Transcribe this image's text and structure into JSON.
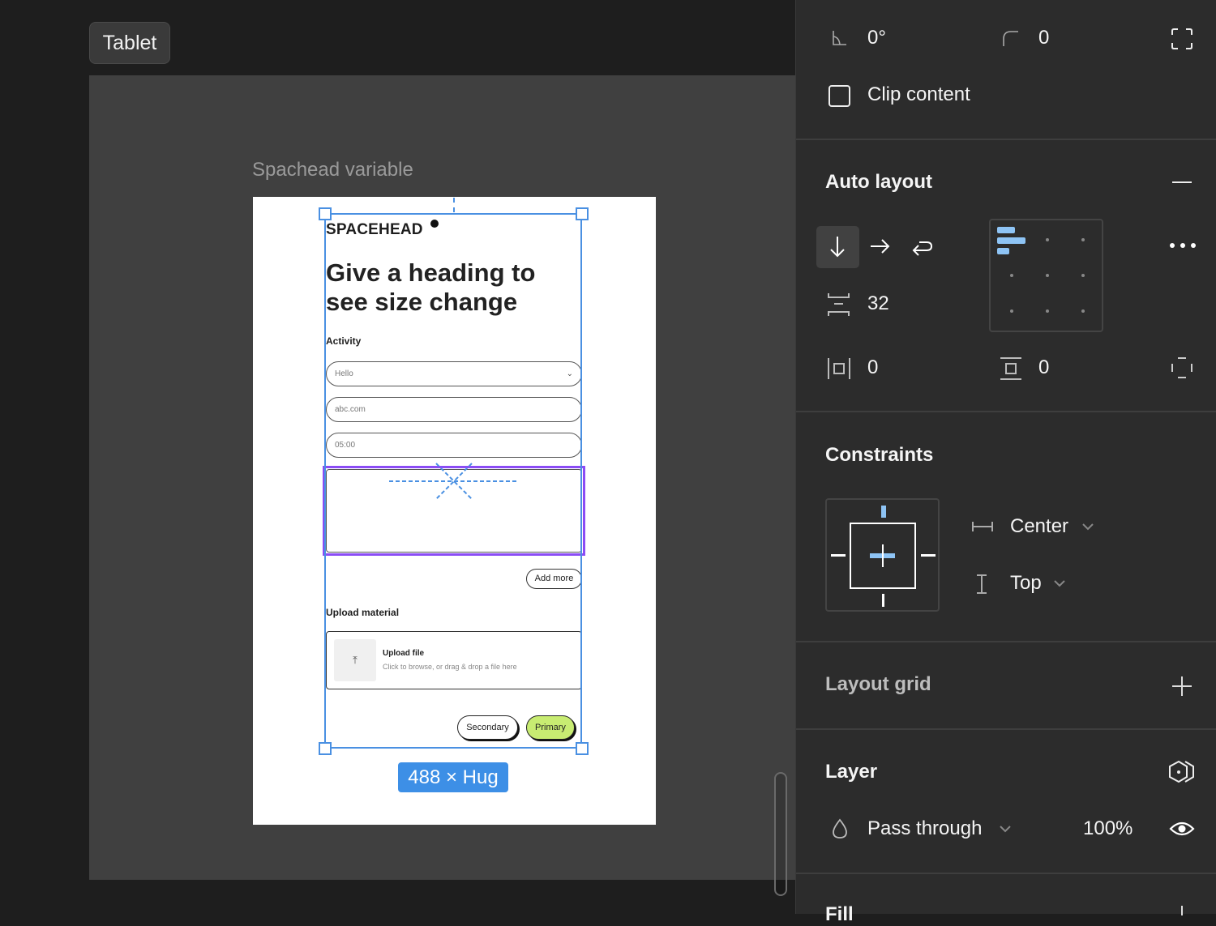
{
  "canvas": {
    "frame_label": "Tablet",
    "artboard_name": "Spachead variable",
    "selection_size": "488 × Hug"
  },
  "artboard": {
    "logo": "SPACEHEAD",
    "heading": "Give a heading to see size change",
    "activity_label": "Activity",
    "fields": [
      {
        "value": "Hello",
        "type": "select"
      },
      {
        "value": "abc.com",
        "type": "text"
      },
      {
        "value": "05:00",
        "type": "text"
      }
    ],
    "add_more_label": "Add more",
    "upload_label": "Upload material",
    "upload_title": "Upload file",
    "upload_subtitle": "Click to browse, or drag & drop a file here",
    "secondary_label": "Secondary",
    "primary_label": "Primary",
    "colors": {
      "primary": "#c8ec72",
      "selection": "#4a90e2",
      "focus": "#8b4cf5"
    }
  },
  "panel": {
    "rotation": "0°",
    "corner_radius": "0",
    "clip_content_label": "Clip content",
    "clip_content_checked": false,
    "auto_layout": {
      "title": "Auto layout",
      "direction": "vertical",
      "gap": "32",
      "padding_horizontal": "0",
      "padding_vertical": "0",
      "alignment": "top-left"
    },
    "constraints": {
      "title": "Constraints",
      "horizontal": "Center",
      "vertical": "Top"
    },
    "layout_grid": {
      "title": "Layout grid"
    },
    "layer": {
      "title": "Layer",
      "blend_mode": "Pass through",
      "opacity": "100%"
    },
    "fill": {
      "title": "Fill"
    }
  }
}
